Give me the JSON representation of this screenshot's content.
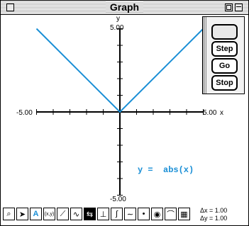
{
  "window": {
    "title": "Graph"
  },
  "axes": {
    "y_max_label": "5.00",
    "y_min_label": "-5.00",
    "x_min_label": "-5.00",
    "x_max_label": "5.00",
    "x_name": "x",
    "y_name": "y"
  },
  "function_label": "y =  abs(x)",
  "colors": {
    "curve": "#1a8fd6",
    "axis": "#000000"
  },
  "controller": {
    "step_label": "Step",
    "go_label": "Go",
    "stop_label": "Stop"
  },
  "tools": [
    "magnifier-icon",
    "arrow-icon",
    "text-A-icon",
    "xy-icon",
    "line-icon",
    "curve-tool-icon",
    "slider-icon",
    "tangent-icon",
    "area-icon",
    "sine-icon",
    "points-icon",
    "eye-icon",
    "wave-icon",
    "grid-icon"
  ],
  "deltas": {
    "dx": "Δx = 1.00",
    "dy": "Δy = 1.00"
  },
  "chart_data": {
    "type": "line",
    "xlim": [
      -5,
      5
    ],
    "ylim": [
      -5,
      5
    ],
    "series": [
      {
        "name": "y = abs(x)",
        "x": [
          -5,
          0,
          5
        ],
        "y": [
          5,
          0,
          5
        ]
      }
    ]
  }
}
